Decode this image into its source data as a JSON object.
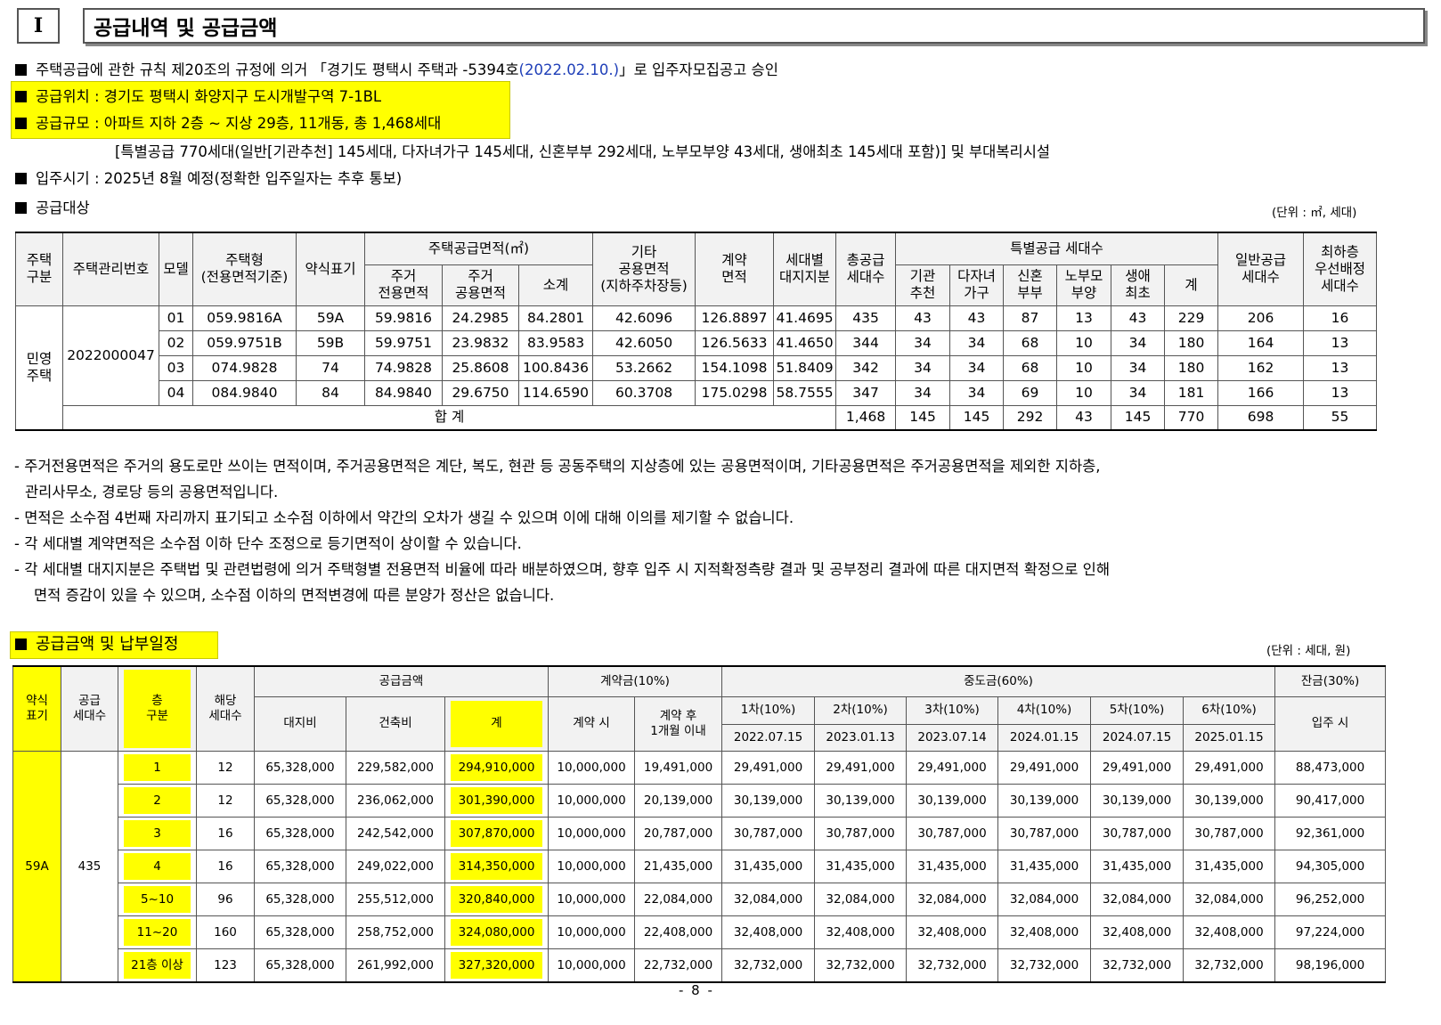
{
  "section": {
    "number": "I",
    "title": "공급내역 및 공급금액"
  },
  "bullets": {
    "approval_pre": "주택공급에 관한 규칙 제20조의 규정에 의거 「경기도 평택시 주택과 -5394호",
    "approval_date": "(2022.02.10.)",
    "approval_post": "」로 입주자모집공고 승인",
    "location": "공급위치 : 경기도 평택시 화양지구 도시개발구역 7-1BL",
    "scale": "공급규모 : 아파트 지하 2층 ~ 지상 29층, 11개동, 총 1,468세대",
    "scale_detail": "[특별공급 770세대(일반[기관추천] 145세대, 다자녀가구 145세대, 신혼부부 292세대, 노부모부양 43세대, 생애최초 145세대 포함)] 및 부대복리시설",
    "move_in": "입주시기 : 2025년 8월 예정(정확한 입주일자는 추후 통보)",
    "target_label": "공급대상",
    "unit1": "(단위 : ㎡, 세대)"
  },
  "supply_table": {
    "headers": {
      "housing_type": "주택\n구분",
      "mgmt_no": "주택관리번호",
      "model": "모델",
      "house_type": "주택형\n(전용면적기준)",
      "abbr": "약식표기",
      "area_group": "주택공급면적(㎡)",
      "exclusive": "주거\n전용면적",
      "common": "주거\n공용면적",
      "subtotal": "소계",
      "other_common": "기타\n공용면적\n(지하주차장등)",
      "contract_area": "계약\n면적",
      "land_share": "세대별\n대지지분",
      "total_supply": "총공급\n세대수",
      "special_group": "특별공급 세대수",
      "institution": "기관\n추천",
      "multi_child": "다자녀\n가구",
      "newlywed": "신혼\n부부",
      "elderly": "노부모\n부양",
      "first_time": "생애\n최초",
      "special_total": "계",
      "general": "일반공급\n세대수",
      "top_floor": "최하층\n우선배정\n세대수"
    },
    "category": "민영\n주택",
    "mgmt_number": "2022000047",
    "rows": [
      [
        "01",
        "059.9816A",
        "59A",
        "59.9816",
        "24.2985",
        "84.2801",
        "42.6096",
        "126.8897",
        "41.4695",
        "435",
        "43",
        "43",
        "87",
        "13",
        "43",
        "229",
        "206",
        "16"
      ],
      [
        "02",
        "059.9751B",
        "59B",
        "59.9751",
        "23.9832",
        "83.9583",
        "42.6050",
        "126.5633",
        "41.4650",
        "344",
        "34",
        "34",
        "68",
        "10",
        "34",
        "180",
        "164",
        "13"
      ],
      [
        "03",
        "074.9828",
        "74",
        "74.9828",
        "25.8608",
        "100.8436",
        "53.2662",
        "154.1098",
        "51.8409",
        "342",
        "34",
        "34",
        "68",
        "10",
        "34",
        "180",
        "162",
        "13"
      ],
      [
        "04",
        "084.9840",
        "84",
        "84.9840",
        "29.6750",
        "114.6590",
        "60.3708",
        "175.0298",
        "58.7555",
        "347",
        "34",
        "34",
        "69",
        "10",
        "34",
        "181",
        "166",
        "13"
      ]
    ],
    "total_label": "합 계",
    "total_row": [
      "1,468",
      "145",
      "145",
      "292",
      "43",
      "145",
      "770",
      "698",
      "55"
    ]
  },
  "notes": [
    "- 주거전용면적은 주거의 용도로만 쓰이는 면적이며, 주거공용면적은 계단, 복도, 현관 등 공동주택의 지상층에 있는 공용면적이며, 기타공용면적은 주거공용면적을 제외한 지하층,",
    "  관리사무소, 경로당 등의 공용면적입니다.",
    "- 면적은 소수점 4번째 자리까지 표기되고 소수점 이하에서 약간의 오차가 생길 수 있으며 이에 대해 이의를 제기할 수 없습니다.",
    "- 각 세대별 계약면적은 소수점 이하 단수 조정으로 등기면적이 상이할 수 있습니다.",
    "- 각 세대별 대지지분은 주택법 및 관련법령에 의거 주택형별 전용면적 비율에 따라 배분하였으며, 향후 입주 시 지적확정측량 결과 및 공부정리 결과에 따른 대지면적 확정으로 인해",
    "   면적 증감이 있을 수 있으며, 소수점 이하의 면적변경에 따른 분양가 정산은 없습니다."
  ],
  "price_section": {
    "title": "공급금액 및 납부일정",
    "unit": "(단위 : 세대, 원)"
  },
  "price_table": {
    "headers": {
      "abbr": "약식\n표기",
      "supply_units": "공급\n세대수",
      "floor": "층\n구분",
      "units": "해당\n세대수",
      "price_group": "공급금액",
      "land": "대지비",
      "building": "건축비",
      "total": "계",
      "deposit_group": "계약금(10%)",
      "on_contract": "계약 시",
      "after_month": "계약 후\n1개월 이내",
      "middle_group": "중도금(60%)",
      "m1": "1차(10%)",
      "m1d": "2022.07.15",
      "m2": "2차(10%)",
      "m2d": "2023.01.13",
      "m3": "3차(10%)",
      "m3d": "2023.07.14",
      "m4": "4차(10%)",
      "m4d": "2024.01.15",
      "m5": "5차(10%)",
      "m5d": "2024.07.15",
      "m6": "6차(10%)",
      "m6d": "2025.01.15",
      "balance_group": "잔금(30%)",
      "move_in": "입주 시"
    },
    "abbr_value": "59A",
    "supply_value": "435",
    "rows": [
      [
        "1",
        "12",
        "65,328,000",
        "229,582,000",
        "294,910,000",
        "10,000,000",
        "19,491,000",
        "29,491,000",
        "29,491,000",
        "29,491,000",
        "29,491,000",
        "29,491,000",
        "29,491,000",
        "88,473,000"
      ],
      [
        "2",
        "12",
        "65,328,000",
        "236,062,000",
        "301,390,000",
        "10,000,000",
        "20,139,000",
        "30,139,000",
        "30,139,000",
        "30,139,000",
        "30,139,000",
        "30,139,000",
        "30,139,000",
        "90,417,000"
      ],
      [
        "3",
        "16",
        "65,328,000",
        "242,542,000",
        "307,870,000",
        "10,000,000",
        "20,787,000",
        "30,787,000",
        "30,787,000",
        "30,787,000",
        "30,787,000",
        "30,787,000",
        "30,787,000",
        "92,361,000"
      ],
      [
        "4",
        "16",
        "65,328,000",
        "249,022,000",
        "314,350,000",
        "10,000,000",
        "21,435,000",
        "31,435,000",
        "31,435,000",
        "31,435,000",
        "31,435,000",
        "31,435,000",
        "31,435,000",
        "94,305,000"
      ],
      [
        "5~10",
        "96",
        "65,328,000",
        "255,512,000",
        "320,840,000",
        "10,000,000",
        "22,084,000",
        "32,084,000",
        "32,084,000",
        "32,084,000",
        "32,084,000",
        "32,084,000",
        "32,084,000",
        "96,252,000"
      ],
      [
        "11~20",
        "160",
        "65,328,000",
        "258,752,000",
        "324,080,000",
        "10,000,000",
        "22,408,000",
        "32,408,000",
        "32,408,000",
        "32,408,000",
        "32,408,000",
        "32,408,000",
        "32,408,000",
        "97,224,000"
      ],
      [
        "21층 이상",
        "123",
        "65,328,000",
        "261,992,000",
        "327,320,000",
        "10,000,000",
        "22,732,000",
        "32,732,000",
        "32,732,000",
        "32,732,000",
        "32,732,000",
        "32,732,000",
        "32,732,000",
        "98,196,000"
      ]
    ]
  },
  "page_number": "- 8 -"
}
